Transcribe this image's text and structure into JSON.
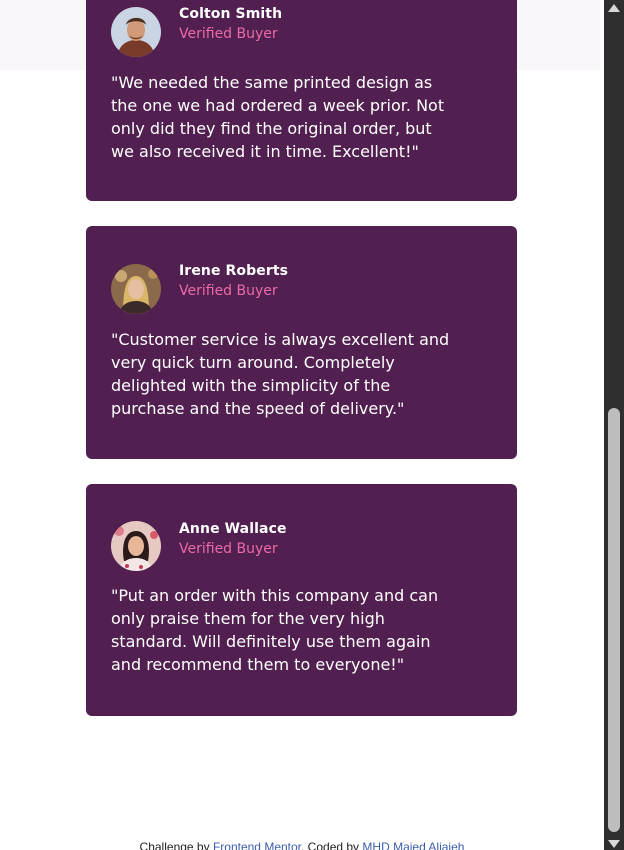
{
  "testimonials": [
    {
      "name": "Colton Smith",
      "role": "Verified Buyer",
      "quote": "\"We needed the same printed design as the one we had ordered a week prior. Not only did they find the original order, but we also received it in time. Excellent!\""
    },
    {
      "name": "Irene Roberts",
      "role": "Verified Buyer",
      "quote": "\"Customer service is always excellent and very quick turn around. Completely delighted with the simplicity of the purchase and the speed of delivery.\""
    },
    {
      "name": "Anne Wallace",
      "role": "Verified Buyer",
      "quote": "\"Put an order with this company and can only praise them for the very high standard. Will definitely use them again and recommend them to everyone!\""
    }
  ],
  "footer": {
    "prefix": "Challenge by",
    "link1": "Frontend Mentor",
    "middle": ". Coded by",
    "link2": "MHD Majed Aljajeh"
  },
  "colors": {
    "card": "#512050",
    "accent": "#ec6aa6",
    "text": "#ffffff"
  }
}
